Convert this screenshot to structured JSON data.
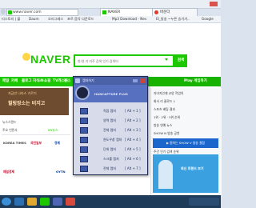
{
  "browser": {
    "url": "www.naver.com",
    "tabs": [
      "NAVER",
      "바운더"
    ],
    "bookmarks": [
      "티스토리 | 블",
      "Daum",
      "오리그레스",
      "포르 음악 다운로드",
      "Mp3 Download - Nev",
      "El_방송 ~누른 승기가..",
      "Google"
    ]
  },
  "page": {
    "logo": "NAVER",
    "search_placeholder": "한/영 키 자주 검색 인기 검색어",
    "search_button": "검색",
    "nav": [
      "메일",
      "카페",
      "블로그",
      "지식iN",
      "쇼핑",
      "TV캐스트",
      "뉴스"
    ],
    "banner_text": [
      "지금만 나타스 기르기",
      "힐링장소는 비지고"
    ],
    "left_lines": [
      "뉴스스탠드",
      "주요 언론사",
      "MY뉴스"
    ],
    "news_logos": [
      "KOREA TIMES",
      "국민일보",
      "경제",
      "매일경제",
      "OYTN"
    ],
    "right_lines": [
      "자녀지인재 교양 작업의",
      "회사 리 클로드 1",
      "스포츠 베팅 결과",
      "1위 · 2위 · 3위 순위",
      "방송 연예 뉴스",
      "SHOW N 방송 공연",
      "주간 인기 검색 순위"
    ],
    "right_header": "Play 게임하기",
    "ad1": "▶ 원하는 SHOW V 방송 결합",
    "ad2": "최신 트렌드 보기"
  },
  "capture_window": {
    "title": "캡처하기",
    "brand": "HANCAPTURE PLUS",
    "items": [
      {
        "label": "직접 캡처",
        "key": "[ Alt + 1 ]"
      },
      {
        "label": "영역 캡처",
        "key": "[ Alt + 2 ]"
      },
      {
        "label": "전체 캡처",
        "key": "[ Alt + 3 ]"
      },
      {
        "label": "윈도우창 캡처",
        "key": "[ Alt + 4 ]"
      },
      {
        "label": "단위 캡처",
        "key": "[ Alt + 5 ]"
      },
      {
        "label": "스크롤 캡처",
        "key": "[ Alt + 6 ]"
      },
      {
        "label": "전체 캡처",
        "key": "[ Alt + 7 ]"
      }
    ]
  },
  "colors": {
    "naver_green": "#1ec800",
    "capture_bg": "#3c4d8a",
    "taskbar": "#1e3c5a"
  }
}
